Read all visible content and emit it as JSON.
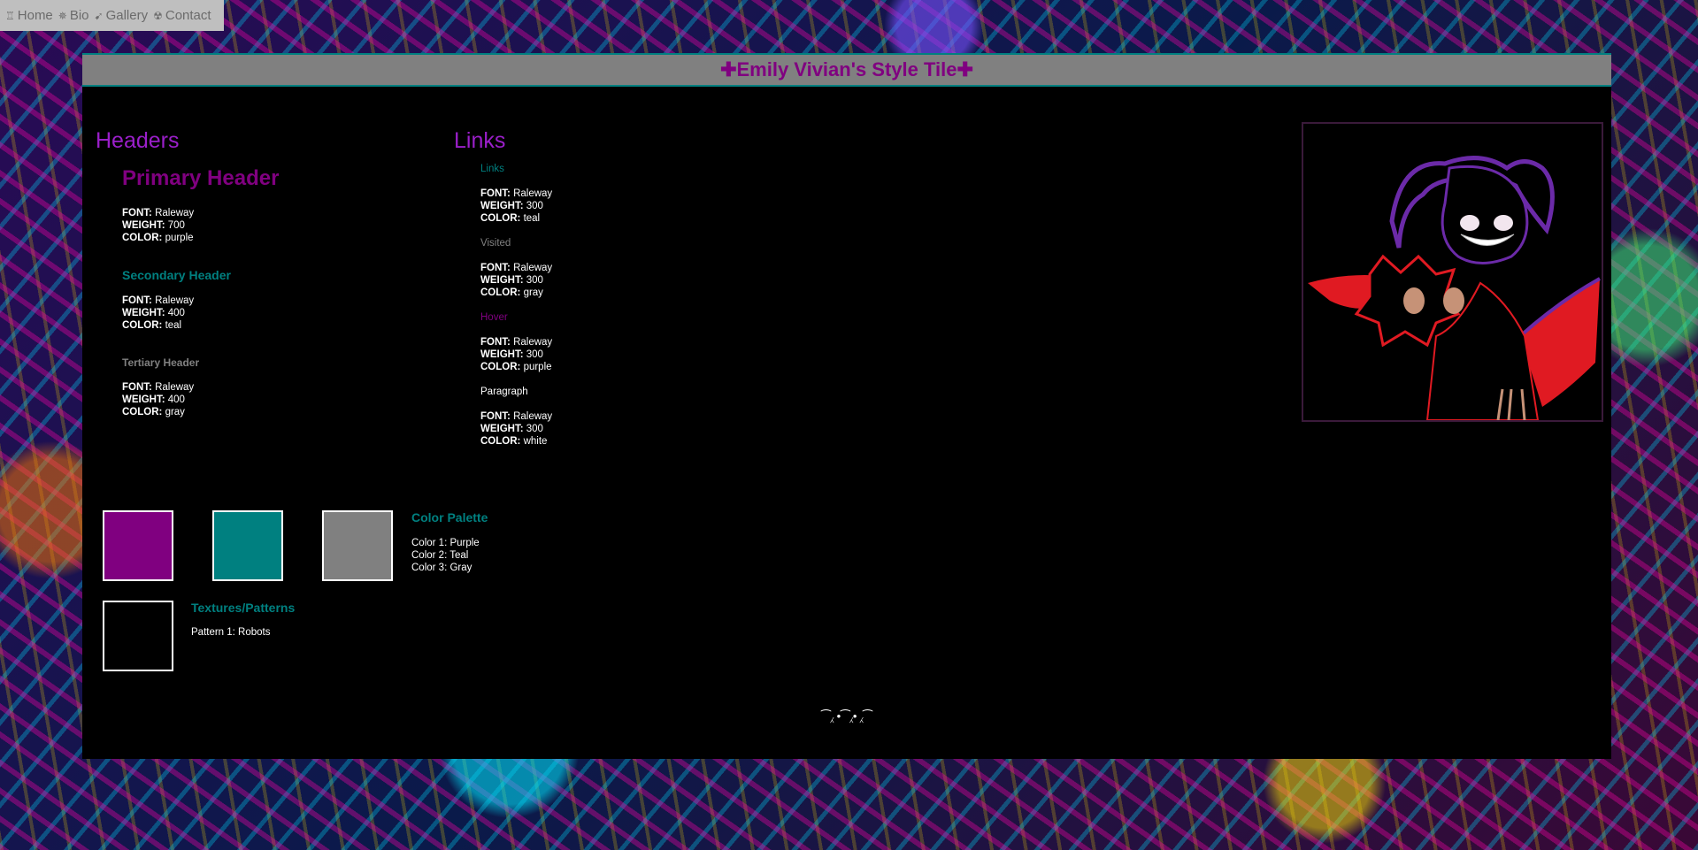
{
  "nav": {
    "items": [
      {
        "icon": "robot-icon",
        "glyph": "♖",
        "label": "Home"
      },
      {
        "icon": "gear-icon",
        "glyph": "✵",
        "label": "Bio"
      },
      {
        "icon": "gun-icon",
        "glyph": "➹",
        "label": "Gallery"
      },
      {
        "icon": "radioactive-icon",
        "glyph": "☢",
        "label": "Contact"
      }
    ]
  },
  "title": "✚Emily Vivian's Style Tile✚",
  "headers": {
    "section_title": "Headers",
    "primary": {
      "sample": "Primary Header",
      "font": "Raleway",
      "weight": "700",
      "color": "purple"
    },
    "secondary": {
      "sample": "Secondary Header",
      "font": "Raleway",
      "weight": "400",
      "color": "teal"
    },
    "tertiary": {
      "sample": "Tertiary Header",
      "font": "Raleway",
      "weight": "400",
      "color": "gray"
    }
  },
  "links": {
    "section_title": "Links",
    "link": {
      "sample": "Links",
      "font": "Raleway",
      "weight": "300",
      "color": "teal"
    },
    "visited": {
      "sample": "Visited",
      "font": "Raleway",
      "weight": "300",
      "color": "gray"
    },
    "hover": {
      "sample": "Hover",
      "font": "Raleway",
      "weight": "300",
      "color": "purple"
    },
    "paragraph": {
      "sample": "Paragraph",
      "font": "Raleway",
      "weight": "300",
      "color": "white"
    }
  },
  "spec_labels": {
    "font": "FONT:",
    "weight": "WEIGHT:",
    "color": "COLOR:"
  },
  "palette": {
    "title": "Color Palette",
    "colors": [
      "#800080",
      "#008080",
      "#808080"
    ],
    "items": [
      "Color 1: Purple",
      "Color 2: Teal",
      "Color 3: Gray"
    ]
  },
  "patterns": {
    "title": "Textures/Patterns",
    "items": [
      "Pattern 1: Robots"
    ]
  },
  "footer_ornament": "⁀⁁ •⁀⁁• ⁁⁀"
}
